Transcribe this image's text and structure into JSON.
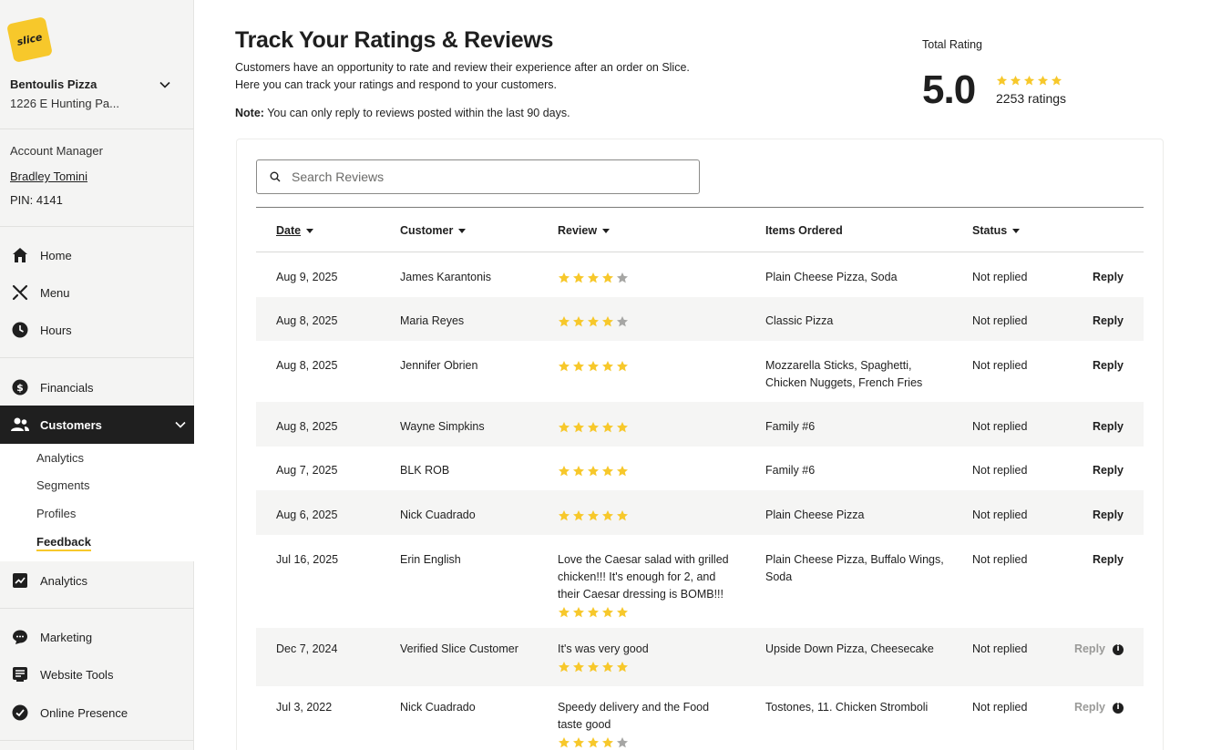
{
  "brand": {
    "logo_text": "slice",
    "accent": "#f7c82b"
  },
  "shop": {
    "name": "Bentoulis Pizza",
    "address": "1226 E Hunting Pa..."
  },
  "account_manager": {
    "label": "Account Manager",
    "name": "Bradley Tomini",
    "pin": "PIN: 4141"
  },
  "nav": {
    "home": "Home",
    "menu": "Menu",
    "hours": "Hours",
    "financials": "Financials",
    "customers": "Customers",
    "customers_sub": [
      "Analytics",
      "Segments",
      "Profiles",
      "Feedback"
    ],
    "analytics": "Analytics",
    "marketing": "Marketing",
    "website_tools": "Website Tools",
    "online_presence": "Online Presence"
  },
  "page": {
    "title": "Track Your Ratings & Reviews",
    "desc_line1": "Customers have an opportunity to rate and review their experience after an order on Slice.",
    "desc_line2": "Here you can track your ratings and respond to your customers.",
    "note_label": "Note:",
    "note_text": " You can only reply to reviews posted within the last 90 days."
  },
  "total_rating": {
    "label": "Total Rating",
    "value": "5.0",
    "count": "2253 ratings",
    "stars": 5
  },
  "search": {
    "placeholder": "Search Reviews"
  },
  "table": {
    "headers": {
      "date": "Date",
      "customer": "Customer",
      "review": "Review",
      "items": "Items Ordered",
      "status": "Status"
    },
    "rows": [
      {
        "date": "Aug 9, 2025",
        "customer": "James Karantonis",
        "review": "",
        "stars": 4,
        "items": "Plain Cheese Pizza, Soda",
        "status": "Not replied",
        "reply": "Reply",
        "reply_enabled": true
      },
      {
        "date": "Aug 8, 2025",
        "customer": "Maria Reyes",
        "review": "",
        "stars": 4,
        "items": "Classic Pizza",
        "status": "Not replied",
        "reply": "Reply",
        "reply_enabled": true
      },
      {
        "date": "Aug 8, 2025",
        "customer": "Jennifer Obrien",
        "review": "",
        "stars": 5,
        "items": "Mozzarella Sticks, Spaghetti, Chicken Nuggets, French Fries",
        "status": "Not replied",
        "reply": "Reply",
        "reply_enabled": true
      },
      {
        "date": "Aug 8, 2025",
        "customer": "Wayne Simpkins",
        "review": "",
        "stars": 5,
        "items": "Family #6",
        "status": "Not replied",
        "reply": "Reply",
        "reply_enabled": true
      },
      {
        "date": "Aug 7, 2025",
        "customer": "BLK ROB",
        "review": "",
        "stars": 5,
        "items": "Family #6",
        "status": "Not replied",
        "reply": "Reply",
        "reply_enabled": true
      },
      {
        "date": "Aug 6, 2025",
        "customer": "Nick Cuadrado",
        "review": "",
        "stars": 5,
        "items": "Plain Cheese Pizza",
        "status": "Not replied",
        "reply": "Reply",
        "reply_enabled": true
      },
      {
        "date": "Jul 16, 2025",
        "customer": "Erin English",
        "review": "Love the Caesar salad with grilled chicken!!! It's enough for 2, and their Caesar dressing is BOMB!!!",
        "stars": 5,
        "items": "Plain Cheese Pizza, Buffalo Wings, Soda",
        "status": "Not replied",
        "reply": "Reply",
        "reply_enabled": true
      },
      {
        "date": "Dec 7, 2024",
        "customer": "Verified Slice Customer",
        "review": "It's was very good",
        "stars": 5,
        "items": "Upside Down Pizza, Cheesecake",
        "status": "Not replied",
        "reply": "Reply",
        "reply_enabled": false
      },
      {
        "date": "Jul 3, 2022",
        "customer": "Nick Cuadrado",
        "review": "Speedy delivery and the Food taste good",
        "stars": 4,
        "items": "Tostones, 11. Chicken Stromboli",
        "status": "Not replied",
        "reply": "Reply",
        "reply_enabled": false
      }
    ]
  }
}
